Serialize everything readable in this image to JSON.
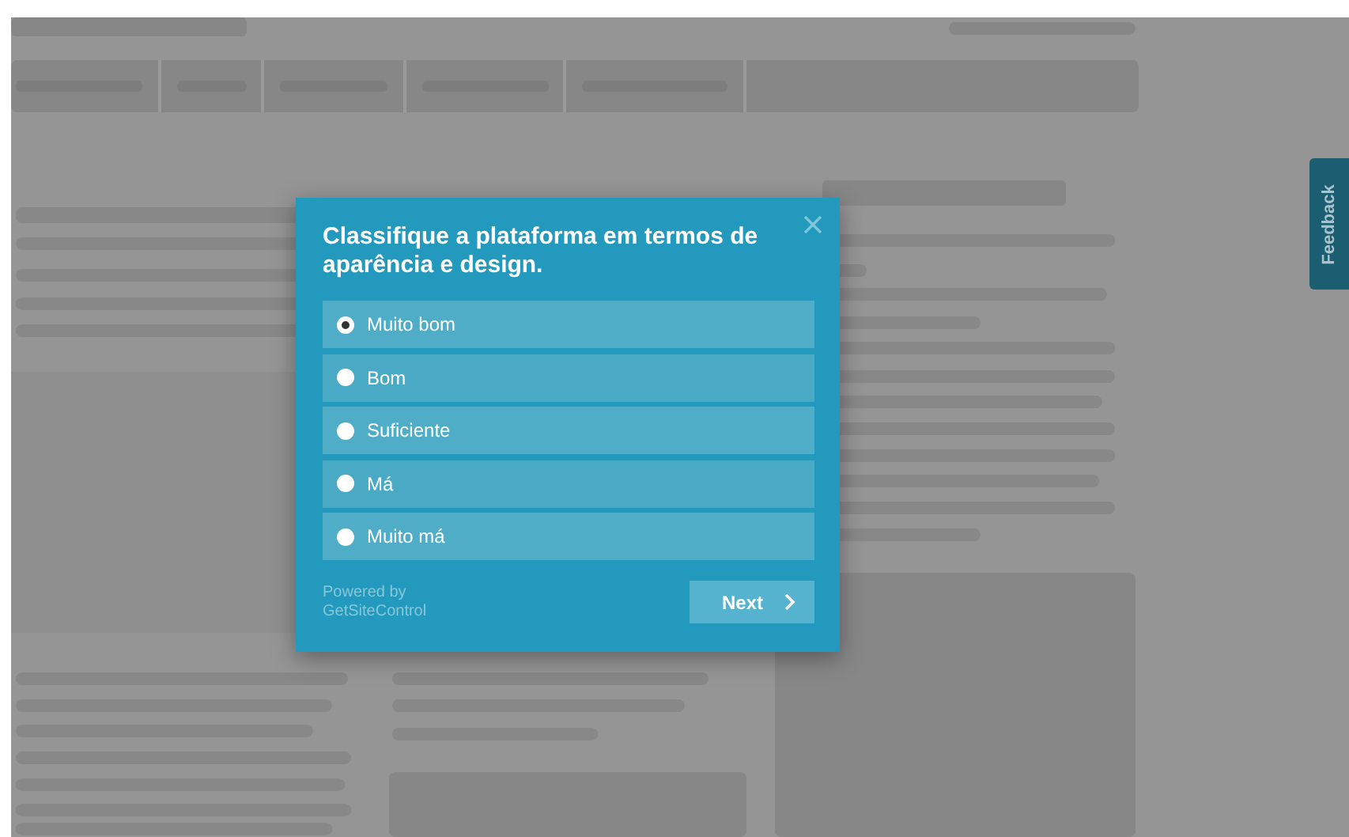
{
  "survey": {
    "title": "Classifique a plataforma em termos de aparência e design.",
    "options": [
      {
        "label": "Muito bom",
        "selected": true
      },
      {
        "label": "Bom",
        "selected": false
      },
      {
        "label": "Suficiente",
        "selected": false
      },
      {
        "label": "Má",
        "selected": false
      },
      {
        "label": "Muito má",
        "selected": false
      }
    ],
    "powered_by": [
      "Powered by",
      "GetSiteControl"
    ],
    "next_button": "Next"
  },
  "feedback_tab": "Feedback"
}
